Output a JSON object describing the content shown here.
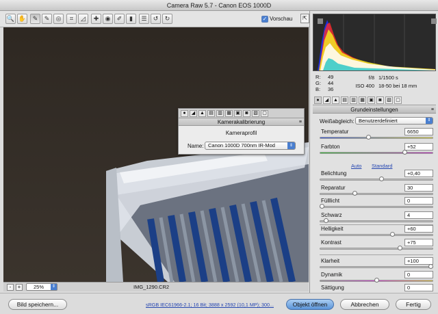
{
  "window": {
    "title": "Camera Raw 5.7 - Canon EOS 1000D"
  },
  "toolbar": {
    "tools": [
      {
        "name": "zoom-tool-icon",
        "glyph": "🔍"
      },
      {
        "name": "hand-tool-icon",
        "glyph": "✋"
      },
      {
        "name": "white-balance-tool-icon",
        "glyph": "✎"
      },
      {
        "name": "color-sampler-tool-icon",
        "glyph": "✎"
      },
      {
        "name": "targeted-adjustment-tool-icon",
        "glyph": "◎"
      },
      {
        "name": "crop-tool-icon",
        "glyph": "⌗"
      },
      {
        "name": "straighten-tool-icon",
        "glyph": "◿"
      },
      {
        "name": "spot-removal-tool-icon",
        "glyph": "✚"
      },
      {
        "name": "red-eye-tool-icon",
        "glyph": "◉"
      },
      {
        "name": "adjustment-brush-icon",
        "glyph": "✐"
      },
      {
        "name": "graduated-filter-icon",
        "glyph": "▮"
      },
      {
        "name": "preferences-icon",
        "glyph": "☰"
      },
      {
        "name": "rotate-left-icon",
        "glyph": "↺"
      },
      {
        "name": "rotate-right-icon",
        "glyph": "↻"
      }
    ],
    "preview_label": "Vorschau",
    "preview_checked": "✓",
    "fullscreen_glyph": "⇱"
  },
  "calibration_panel": {
    "title": "Kamerakalibrierung",
    "section": "Kameraprofil",
    "name_label": "Name:",
    "name_value": "Canon 1000D 700nm IR-Mod",
    "menu_glyph": "≡"
  },
  "status": {
    "zoom_minus": "-",
    "zoom_plus": "+",
    "zoom_value": "25%",
    "filename": "IMG_1290.CR2"
  },
  "readout": {
    "r_label": "R:",
    "r_value": "49",
    "g_label": "G:",
    "g_value": "44",
    "b_label": "B:",
    "b_value": "36",
    "aperture": "f/8",
    "shutter": "1/1500 s",
    "iso": "ISO 400",
    "lens": "18-50 bei 18 mm"
  },
  "basic_panel": {
    "title": "Grundeinstellungen",
    "menu_glyph": "≡",
    "wb_label": "Weißabgleich:",
    "wb_value": "Benutzerdefiniert",
    "auto_label": "Auto",
    "standard_label": "Standard",
    "sliders": [
      {
        "key": "temperatur",
        "label": "Temperatur",
        "value": "6650",
        "level": 0.43
      },
      {
        "key": "farbton",
        "label": "Farbton",
        "value": "+52",
        "level": 0.76
      },
      {
        "key": "belichtung",
        "label": "Belichtung",
        "value": "+0,40",
        "level": 0.55
      },
      {
        "key": "reparatur",
        "label": "Reparatur",
        "value": "30",
        "level": 0.3
      },
      {
        "key": "fuelllicht",
        "label": "Fülllicht",
        "value": "0",
        "level": 0.0
      },
      {
        "key": "schwarz",
        "label": "Schwarz",
        "value": "4",
        "level": 0.04
      },
      {
        "key": "helligkeit",
        "label": "Helligkeit",
        "value": "+60",
        "level": 0.65
      },
      {
        "key": "kontrast",
        "label": "Kontrast",
        "value": "+75",
        "level": 0.72
      },
      {
        "key": "klarheit",
        "label": "Klarheit",
        "value": "+100",
        "level": 1.0
      },
      {
        "key": "dynamik",
        "label": "Dynamik",
        "value": "0",
        "level": 0.5
      },
      {
        "key": "saettigung",
        "label": "Sättigung",
        "value": "0",
        "level": 0.5
      }
    ]
  },
  "bottom": {
    "save_label": "Bild speichern...",
    "info_text": "sRGB IEC61966-2.1; 16 Bit; 3888 x 2592 (10,1 MP); 300...",
    "open_label": "Objekt öffnen",
    "cancel_label": "Abbrechen",
    "done_label": "Fertig"
  },
  "colors": {
    "accent": "#4a7fd0",
    "link": "#2445b0",
    "image_background": "#2b2520"
  }
}
